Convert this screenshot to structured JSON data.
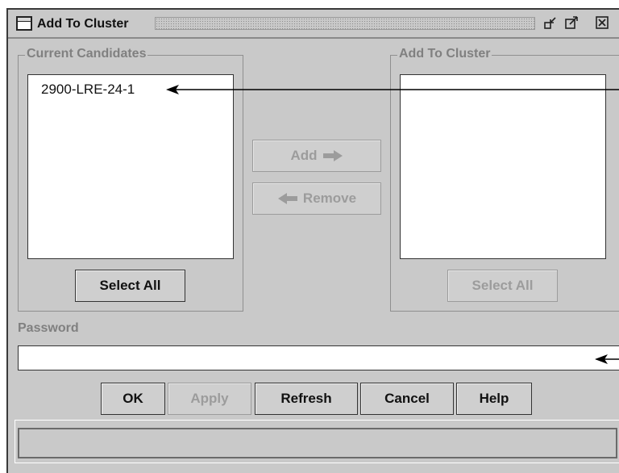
{
  "window": {
    "title": "Add To Cluster",
    "controls": [
      "minimize-icon",
      "maximize-icon",
      "close-icon"
    ]
  },
  "candidates": {
    "label": "Current Candidates",
    "items": [
      "2900-LRE-24-1"
    ],
    "select_all_label": "Select All"
  },
  "middle": {
    "add_label": "Add",
    "remove_label": "Remove"
  },
  "cluster": {
    "label": "Add To Cluster",
    "items": [],
    "select_all_label": "Select All"
  },
  "password": {
    "label": "Password",
    "value": ""
  },
  "buttons": {
    "ok": "OK",
    "apply": "Apply",
    "refresh": "Refresh",
    "cancel": "Cancel",
    "help": "Help"
  },
  "status_bar": {
    "text": ""
  }
}
